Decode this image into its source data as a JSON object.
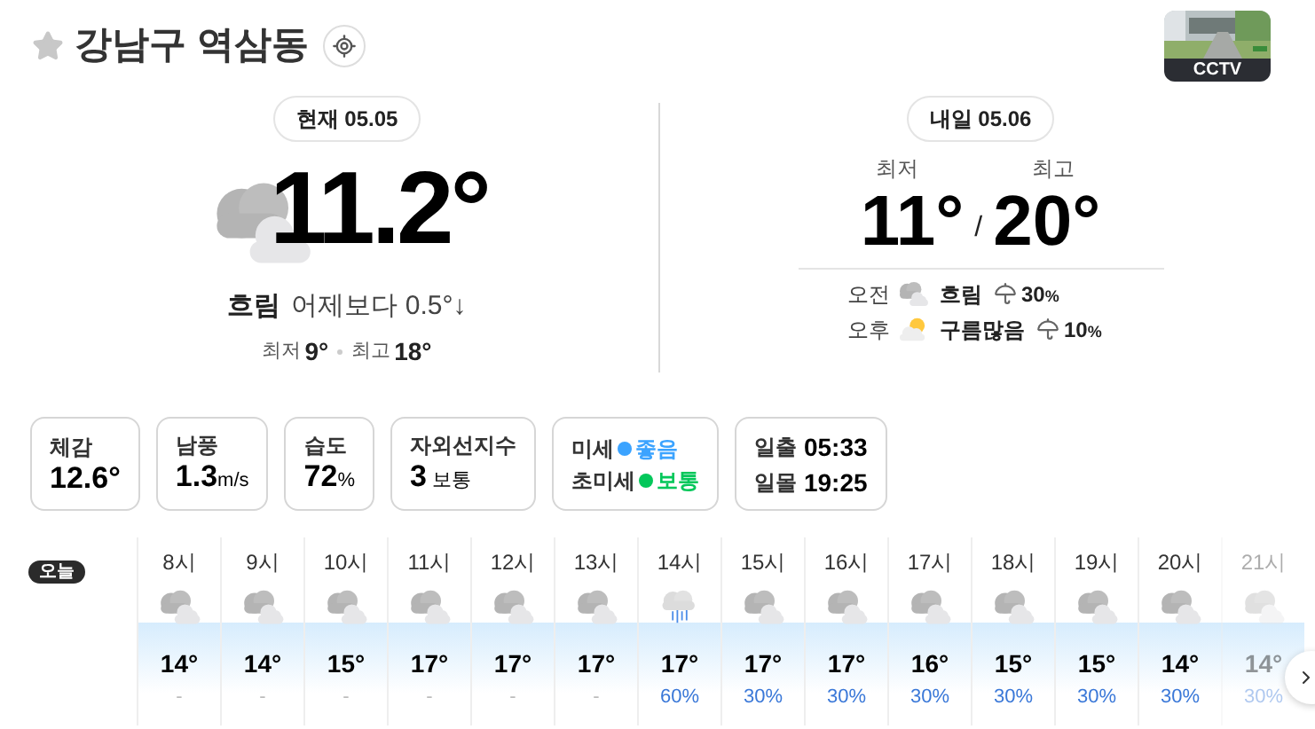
{
  "header": {
    "favorite": false,
    "title": "강남구 역삼동",
    "cctv_label": "CCTV"
  },
  "today": {
    "badge": "현재 05.05",
    "temp": "11.2°",
    "kind": "cloudy",
    "condition": "흐림",
    "compare": "어제보다 0.5°↓",
    "low_label": "최저",
    "low": "9°",
    "high_label": "최고",
    "high": "18°"
  },
  "tomorrow": {
    "badge": "내일 05.06",
    "low_label": "최저",
    "high_label": "최고",
    "low": "11°",
    "separator": "/",
    "high": "20°",
    "periods": [
      {
        "label": "오전",
        "kind": "cloudy",
        "condition": "흐림",
        "precip": "30",
        "unit": "%"
      },
      {
        "label": "오후",
        "kind": "sun_cloud",
        "condition": "구름많음",
        "precip": "10",
        "unit": "%"
      }
    ]
  },
  "cards": [
    {
      "kind": "stat",
      "label": "체감",
      "value": "12.6°"
    },
    {
      "kind": "stat",
      "label": "남풍",
      "value": "1.3",
      "unit": "m/s"
    },
    {
      "kind": "stat",
      "label": "습도",
      "value": "72",
      "unit": "%"
    },
    {
      "kind": "stat",
      "label": "자외선지수",
      "value": "3",
      "unit": "보통"
    },
    {
      "kind": "dust",
      "rows": [
        {
          "label": "미세",
          "status": "좋음",
          "color": "#3ba3ff"
        },
        {
          "label": "초미세",
          "status": "보통",
          "color": "#03c75a"
        }
      ]
    },
    {
      "kind": "sun",
      "rows": [
        {
          "label": "일출",
          "value": "05:33"
        },
        {
          "label": "일몰",
          "value": "19:25"
        }
      ]
    }
  ],
  "hourly": {
    "day_badge": "오늘",
    "hours": [
      {
        "time": "8시",
        "kind": "cloudy",
        "temp": "14°",
        "precip": "-",
        "faded": false
      },
      {
        "time": "9시",
        "kind": "cloudy",
        "temp": "14°",
        "precip": "-",
        "faded": false
      },
      {
        "time": "10시",
        "kind": "cloudy",
        "temp": "15°",
        "precip": "-",
        "faded": false
      },
      {
        "time": "11시",
        "kind": "cloudy",
        "temp": "17°",
        "precip": "-",
        "faded": false
      },
      {
        "time": "12시",
        "kind": "cloudy",
        "temp": "17°",
        "precip": "-",
        "faded": false
      },
      {
        "time": "13시",
        "kind": "cloudy",
        "temp": "17°",
        "precip": "-",
        "faded": false
      },
      {
        "time": "14시",
        "kind": "rain",
        "temp": "17°",
        "precip": "60%",
        "faded": false
      },
      {
        "time": "15시",
        "kind": "cloudy",
        "temp": "17°",
        "precip": "30%",
        "faded": false
      },
      {
        "time": "16시",
        "kind": "cloudy",
        "temp": "17°",
        "precip": "30%",
        "faded": false
      },
      {
        "time": "17시",
        "kind": "cloudy",
        "temp": "16°",
        "precip": "30%",
        "faded": false
      },
      {
        "time": "18시",
        "kind": "cloudy",
        "temp": "15°",
        "precip": "30%",
        "faded": false
      },
      {
        "time": "19시",
        "kind": "cloudy",
        "temp": "15°",
        "precip": "30%",
        "faded": false
      },
      {
        "time": "20시",
        "kind": "cloudy",
        "temp": "14°",
        "precip": "30%",
        "faded": false
      },
      {
        "time": "21시",
        "kind": "cloudy",
        "temp": "14°",
        "precip": "30%",
        "faded": true
      }
    ]
  }
}
